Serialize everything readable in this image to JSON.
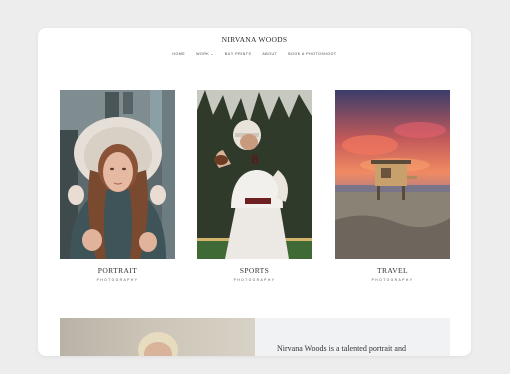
{
  "site": {
    "title": "NIRVANA WOODS"
  },
  "nav": {
    "items": [
      "HOME",
      "WORK",
      "BUY PRINTS",
      "ABOUT",
      "BOOK A PHOTOSHOOT"
    ],
    "work_chevron": "⌄"
  },
  "gallery": [
    {
      "title": "PORTRAIT",
      "subtitle": "PHOTOGRAPHY"
    },
    {
      "title": "SPORTS",
      "subtitle": "PHOTOGRAPHY"
    },
    {
      "title": "TRAVEL",
      "subtitle": "PHOTOGRAPHY"
    }
  ],
  "about": {
    "text": "Nirvana Woods is a talented portrait and"
  },
  "colors": {
    "page_background": "#ededed",
    "window_background": "#ffffff",
    "about_panel": "#f1f2f4"
  }
}
